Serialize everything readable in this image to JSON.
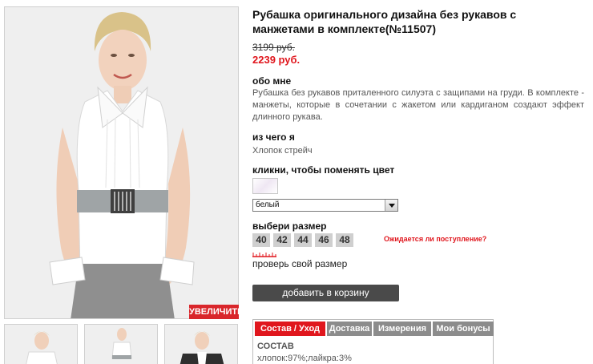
{
  "gallery": {
    "zoom_label": "УВЕЛИЧИТЬ"
  },
  "product": {
    "title": "Рубашка оригинального дизайна без рукавов с манжетами в комплекте(№11507)",
    "old_price": "3199 руб.",
    "new_price": "2239 руб."
  },
  "about": {
    "heading": "обо мне",
    "text": "Рубашка без рукавов приталенного силуэта с защипами на груди. В комплекте - манжеты, которые в сочетании с жакетом или кардиганом создают эффект длинного рукава."
  },
  "material": {
    "heading": "из чего я",
    "text": "Хлопок стрейч"
  },
  "color": {
    "heading": "кликни, чтобы поменять цвет",
    "selected": "белый",
    "swatch_color": "#f1eaf4"
  },
  "size": {
    "heading": "выбери размер",
    "options": [
      "40",
      "42",
      "44",
      "46",
      "48"
    ],
    "waiting_link": "Ожидается ли поступление?",
    "check_link": "проверь свой размер"
  },
  "cart": {
    "button_label": "добавить в корзину"
  },
  "tabs": {
    "items": [
      "Состав / Уход",
      "Доставка",
      "Измерения",
      "Мои бонусы"
    ],
    "active_index": 0,
    "content_title": "СОСТАВ",
    "content_text": "хлопок:97%;лайкра:3%"
  },
  "colors": {
    "accent": "#e0161d",
    "button_dark": "#4a4a4a",
    "tab_inactive": "#8c8c8c",
    "size_bg": "#cfcfcf"
  }
}
